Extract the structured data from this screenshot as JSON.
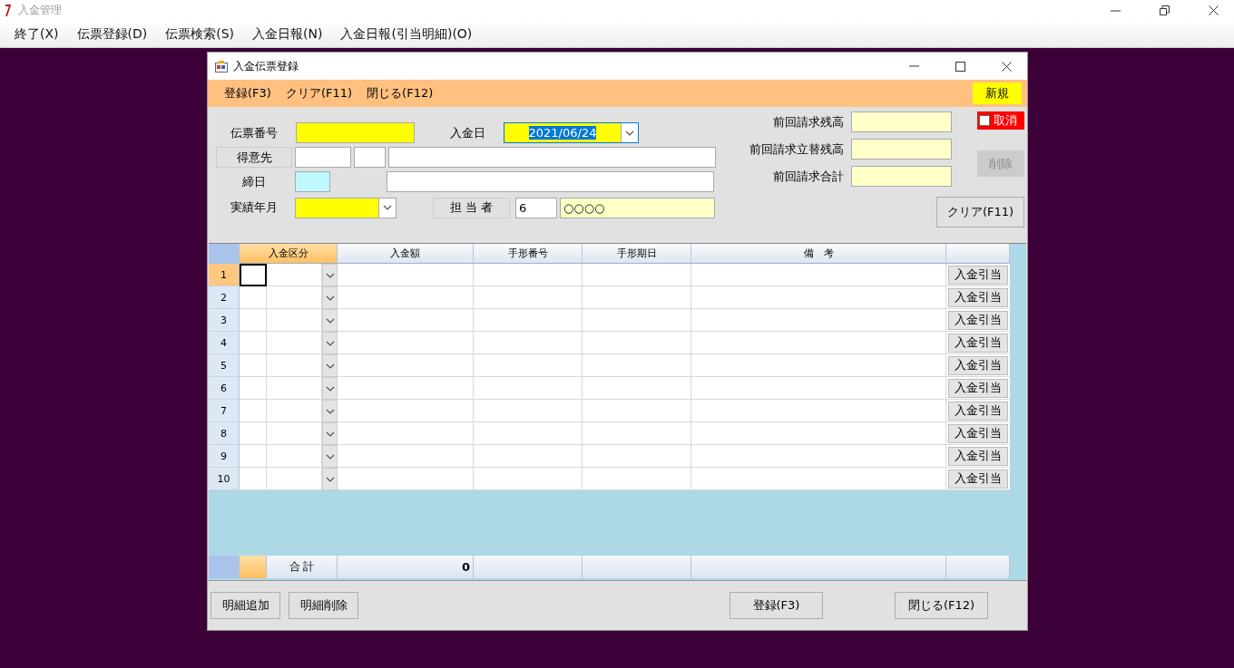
{
  "app": {
    "title": "入金管理"
  },
  "menu": [
    "終了(X)",
    "伝票登録(D)",
    "伝票検索(S)",
    "入金日報(N)",
    "入金日報(引当明細)(O)"
  ],
  "dialog": {
    "title": "入金伝票登録",
    "toolbar": [
      "登録(F3)",
      "クリア(F11)",
      "閉じる(F12)"
    ],
    "mode": "新規"
  },
  "form": {
    "slip_no": {
      "label": "伝票番号"
    },
    "payment_date": {
      "label": "入金日",
      "value": "2021/06/24"
    },
    "customer": {
      "label": "得意先"
    },
    "closing_day": {
      "label": "締日"
    },
    "period": {
      "label": "実績年月"
    },
    "staff": {
      "label": "担 当 者",
      "code": "6",
      "name": "○○○○"
    },
    "summary": [
      {
        "label": "前回請求残高"
      },
      {
        "label": "前回請求立替残高"
      },
      {
        "label": "前回請求合計"
      }
    ],
    "cancel": {
      "label": "取消",
      "checked": false
    },
    "delete_button": {
      "label": "削除",
      "disabled": true
    },
    "clear_button": {
      "label": "クリア(F11)"
    }
  },
  "grid": {
    "columns": [
      "入金区分",
      "入金額",
      "手形番号",
      "手形期日",
      "備　考"
    ],
    "rows": [
      {
        "number": "1",
        "button": "入金引当",
        "selected": true
      },
      {
        "number": "2",
        "button": "入金引当",
        "selected": false
      },
      {
        "number": "3",
        "button": "入金引当",
        "selected": false
      },
      {
        "number": "4",
        "button": "入金引当",
        "selected": false
      },
      {
        "number": "5",
        "button": "入金引当",
        "selected": false
      },
      {
        "number": "6",
        "button": "入金引当",
        "selected": false
      },
      {
        "number": "7",
        "button": "入金引当",
        "selected": false
      },
      {
        "number": "8",
        "button": "入金引当",
        "selected": false
      },
      {
        "number": "9",
        "button": "入金引当",
        "selected": false
      },
      {
        "number": "10",
        "button": "入金引当",
        "selected": false
      }
    ],
    "total": {
      "label": "合 計",
      "amount": "0"
    }
  },
  "footer": {
    "left": [
      "明細追加",
      "明細削除"
    ],
    "right": [
      "登録(F3)",
      "閉じる(F12)"
    ]
  }
}
